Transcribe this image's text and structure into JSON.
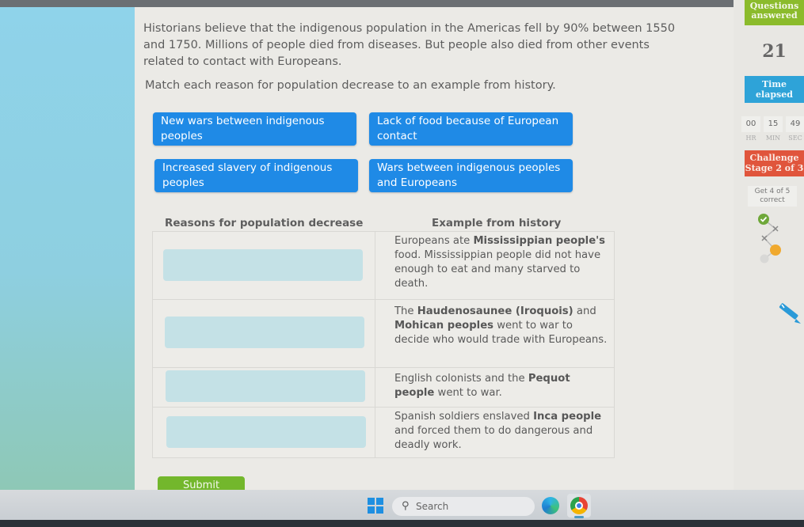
{
  "intro": {
    "paragraph": "Historians believe that the indigenous population in the Americas fell by 90% between 1550 and 1750. Millions of people died from diseases. But people also died from other events related to contact with Europeans.",
    "instruction": "Match each reason for population decrease to an example from history."
  },
  "tiles": [
    {
      "label": "New wars between indigenous peoples"
    },
    {
      "label": "Lack of food because of European contact"
    },
    {
      "label": "Increased slavery of indigenous peoples"
    },
    {
      "label": "Wars between indigenous peoples and Europeans"
    }
  ],
  "table": {
    "col_reasons": "Reasons for population decrease",
    "col_examples": "Example from history",
    "rows": [
      {
        "parts": [
          [
            "Europeans ate ",
            false
          ],
          [
            "Mississippian people's",
            true
          ],
          [
            " food. Mississippian people did not have enough to eat and many starved to death.",
            false
          ]
        ]
      },
      {
        "parts": [
          [
            "The ",
            false
          ],
          [
            "Haudenosaunee (Iroquois)",
            true
          ],
          [
            " and ",
            false
          ],
          [
            "Mohican peoples",
            true
          ],
          [
            " went to war to decide who would trade with Europeans.",
            false
          ]
        ]
      },
      {
        "parts": [
          [
            "English colonists and the ",
            false
          ],
          [
            "Pequot people",
            true
          ],
          [
            " went to war.",
            false
          ]
        ]
      },
      {
        "parts": [
          [
            "Spanish soldiers enslaved ",
            false
          ],
          [
            "Inca people",
            true
          ],
          [
            " and forced them to do dangerous and deadly work.",
            false
          ]
        ]
      }
    ]
  },
  "submit_label": "Submit",
  "sidebar": {
    "questions_answered_label": "Questions answered",
    "questions_answered": "21",
    "time_elapsed_label": "Time elapsed",
    "timer": {
      "hr": "00",
      "min": "15",
      "sec": "49",
      "hr_label": "HR",
      "min_label": "MIN",
      "sec_label": "SEC"
    },
    "challenge_label": "Challenge",
    "stage_label": "Stage 2 of 3",
    "goal_text": "Get 4 of 5 correct",
    "progress": [
      "correct",
      "incorrect",
      "incorrect",
      "current",
      "pending"
    ],
    "colors": {
      "questions": "#8bbb2c",
      "time": "#2ea3d8",
      "challenge": "#e0553c",
      "correct": "#6fa83a",
      "current": "#f0a92e"
    }
  },
  "taskbar": {
    "search_placeholder": "Search",
    "icons": [
      "windows-start-icon",
      "search-icon",
      "edge-icon",
      "chrome-icon"
    ]
  }
}
